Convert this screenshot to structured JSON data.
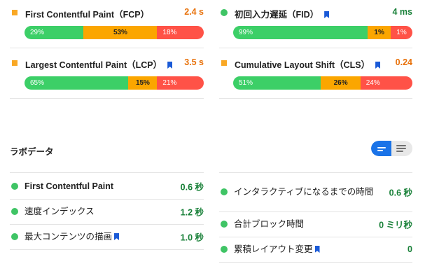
{
  "field_metrics": [
    {
      "name": "First Contentful Paint（FCP）",
      "value": "2.4 s",
      "status_color": "#f9a825",
      "value_color": "orange",
      "bookmark": false,
      "distribution": [
        {
          "type": "good",
          "label": "29%",
          "pct": 29
        },
        {
          "type": "ni",
          "label": "53%",
          "pct": 53
        },
        {
          "type": "poor",
          "label": "18%",
          "pct": 18
        }
      ]
    },
    {
      "name": "初回入力遅延（FID）",
      "value": "4 ms",
      "status_color": "#3fc465",
      "value_color": "green",
      "bookmark": true,
      "distribution": [
        {
          "type": "good",
          "label": "99%",
          "pct": 99
        },
        {
          "type": "ni",
          "label": "1%",
          "pct": 1
        },
        {
          "type": "poor",
          "label": "1%",
          "pct": 1
        }
      ]
    },
    {
      "name": "Largest Contentful Paint（LCP）",
      "value": "3.5 s",
      "status_color": "#f9a825",
      "value_color": "orange",
      "bookmark": true,
      "distribution": [
        {
          "type": "good",
          "label": "65%",
          "pct": 65
        },
        {
          "type": "ni",
          "label": "15%",
          "pct": 15
        },
        {
          "type": "poor",
          "label": "21%",
          "pct": 21
        }
      ]
    },
    {
      "name": "Cumulative Layout Shift（CLS）",
      "value": "0.24",
      "status_color": "#f9a825",
      "value_color": "orange",
      "bookmark": true,
      "distribution": [
        {
          "type": "good",
          "label": "51%",
          "pct": 51
        },
        {
          "type": "ni",
          "label": "26%",
          "pct": 26
        },
        {
          "type": "poor",
          "label": "24%",
          "pct": 24
        }
      ]
    }
  ],
  "lab_data": {
    "title": "ラボデータ",
    "view_toggle": {
      "active": "summary-view",
      "icons": [
        "list-summary-icon",
        "list-detail-icon"
      ]
    },
    "left": [
      {
        "name": "First Contentful Paint",
        "value": "0.6 秒",
        "bold": true,
        "bookmark": false
      },
      {
        "name": "速度インデックス",
        "value": "1.2 秒",
        "bold": false,
        "bookmark": false
      },
      {
        "name": "最大コンテンツの描画",
        "value": "1.0 秒",
        "bold": false,
        "bookmark": true
      }
    ],
    "right": [
      {
        "name": "インタラクティブになるまでの時間",
        "value": "0.6 秒",
        "bold": false,
        "bookmark": false
      },
      {
        "name": "合計ブロック時間",
        "value": "0 ミリ秒",
        "bold": false,
        "bookmark": false
      },
      {
        "name": "累積レイアウト変更",
        "value": "0",
        "bold": false,
        "bookmark": true
      }
    ]
  },
  "colors": {
    "good": "#3ccf67",
    "needs_improvement": "#fba600",
    "poor": "#ff5247",
    "accent": "#1a73e8",
    "bookmark": "#1a5ad7"
  }
}
